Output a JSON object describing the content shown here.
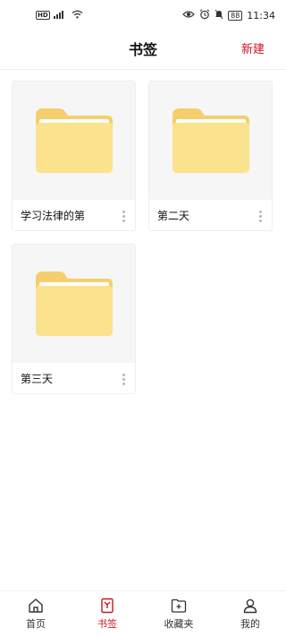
{
  "status_bar": {
    "network_badge": "HD",
    "battery": "88",
    "time": "11:34"
  },
  "header": {
    "title": "书签",
    "action_label": "新建"
  },
  "folders": [
    {
      "name": "学习法律的第"
    },
    {
      "name": "第二天"
    },
    {
      "name": "第三天"
    }
  ],
  "tab_bar": {
    "active_tab": "书签",
    "tabs": [
      {
        "label": "首页",
        "icon": "home-icon"
      },
      {
        "label": "书签",
        "icon": "bookmark-icon"
      },
      {
        "label": "收藏夹",
        "icon": "collection-folder-icon"
      },
      {
        "label": "我的",
        "icon": "profile-icon"
      }
    ]
  },
  "colors": {
    "accent": "#c8161d",
    "folder_body": "#fbe38e",
    "folder_back": "#f5cf6e",
    "card_thumb_bg": "#f6f6f6"
  }
}
